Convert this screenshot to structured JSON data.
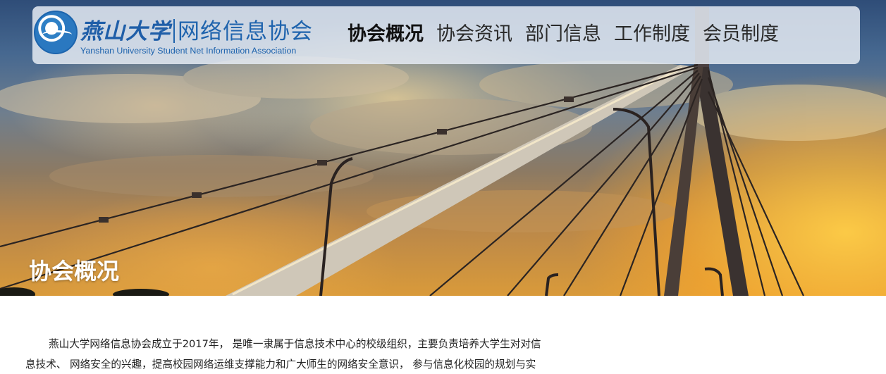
{
  "logo": {
    "cn_school": "燕山大学",
    "cn_assoc": "网络信息协会",
    "en": "Yanshan University Student Net Information Association"
  },
  "nav": {
    "items": [
      {
        "label": "协会概况",
        "active": true
      },
      {
        "label": "协会资讯",
        "active": false
      },
      {
        "label": "部门信息",
        "active": false
      },
      {
        "label": "工作制度",
        "active": false
      },
      {
        "label": "会员制度",
        "active": false
      }
    ]
  },
  "hero": {
    "title": "协会概况"
  },
  "content": {
    "line1": "燕山大学网络信息协会成立于2017年， 是唯一隶属于信息技术中心的校级组织，主要负责培养大学生对对信",
    "line2": "息技术、 网络安全的兴趣，提高校园网络运维支撑能力和广大师生的网络安全意识， 参与信息化校园的规划与实"
  },
  "colors": {
    "navbar_bg": "#e4eaf2",
    "logo_blue": "#1e63ad",
    "hero_title": "#ffffff",
    "body_text": "#222222"
  }
}
